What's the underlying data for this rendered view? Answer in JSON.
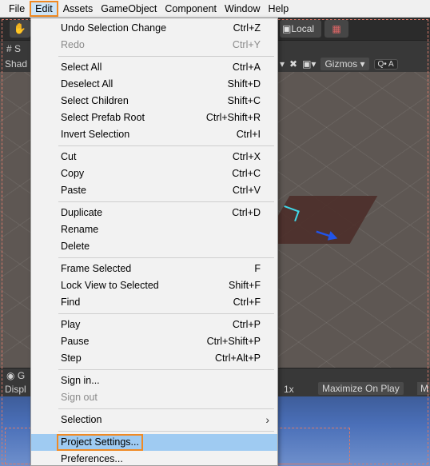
{
  "menubar": {
    "items": [
      "File",
      "Edit",
      "Assets",
      "GameObject",
      "Component",
      "Window",
      "Help"
    ],
    "active": "Edit"
  },
  "toolbar": {
    "hand_icon": "hand-icon",
    "local_label": "Local",
    "grid_icon": "grid-snap-icon"
  },
  "scene": {
    "tab_label": "# S",
    "shading_label": "Shad",
    "gizmos_label": "Gizmos",
    "search_label": "Q• A"
  },
  "game": {
    "tab_label": "G",
    "display_label": "Displ",
    "scale_label": "1x",
    "maximize_label": "Maximize On Play",
    "m_label": "M"
  },
  "edit_menu": {
    "groups": [
      [
        {
          "label": "Undo Selection Change",
          "shortcut": "Ctrl+Z",
          "disabled": false
        },
        {
          "label": "Redo",
          "shortcut": "Ctrl+Y",
          "disabled": true
        }
      ],
      [
        {
          "label": "Select All",
          "shortcut": "Ctrl+A",
          "disabled": false
        },
        {
          "label": "Deselect All",
          "shortcut": "Shift+D",
          "disabled": false
        },
        {
          "label": "Select Children",
          "shortcut": "Shift+C",
          "disabled": false
        },
        {
          "label": "Select Prefab Root",
          "shortcut": "Ctrl+Shift+R",
          "disabled": false
        },
        {
          "label": "Invert Selection",
          "shortcut": "Ctrl+I",
          "disabled": false
        }
      ],
      [
        {
          "label": "Cut",
          "shortcut": "Ctrl+X",
          "disabled": false
        },
        {
          "label": "Copy",
          "shortcut": "Ctrl+C",
          "disabled": false
        },
        {
          "label": "Paste",
          "shortcut": "Ctrl+V",
          "disabled": false
        }
      ],
      [
        {
          "label": "Duplicate",
          "shortcut": "Ctrl+D",
          "disabled": false
        },
        {
          "label": "Rename",
          "shortcut": "",
          "disabled": false
        },
        {
          "label": "Delete",
          "shortcut": "",
          "disabled": false
        }
      ],
      [
        {
          "label": "Frame Selected",
          "shortcut": "F",
          "disabled": false
        },
        {
          "label": "Lock View to Selected",
          "shortcut": "Shift+F",
          "disabled": false
        },
        {
          "label": "Find",
          "shortcut": "Ctrl+F",
          "disabled": false
        }
      ],
      [
        {
          "label": "Play",
          "shortcut": "Ctrl+P",
          "disabled": false
        },
        {
          "label": "Pause",
          "shortcut": "Ctrl+Shift+P",
          "disabled": false
        },
        {
          "label": "Step",
          "shortcut": "Ctrl+Alt+P",
          "disabled": false
        }
      ],
      [
        {
          "label": "Sign in...",
          "shortcut": "",
          "disabled": false
        },
        {
          "label": "Sign out",
          "shortcut": "",
          "disabled": true
        }
      ],
      [
        {
          "label": "Selection",
          "shortcut": "",
          "disabled": false,
          "submenu": true
        }
      ],
      [
        {
          "label": "Project Settings...",
          "shortcut": "",
          "disabled": false,
          "highlighted": true
        },
        {
          "label": "Preferences...",
          "shortcut": "",
          "disabled": false
        }
      ]
    ]
  },
  "colors": {
    "highlight_border": "#f08a24",
    "menu_hover": "#9fcbf2",
    "active_menu_bg": "#cce4f7"
  }
}
